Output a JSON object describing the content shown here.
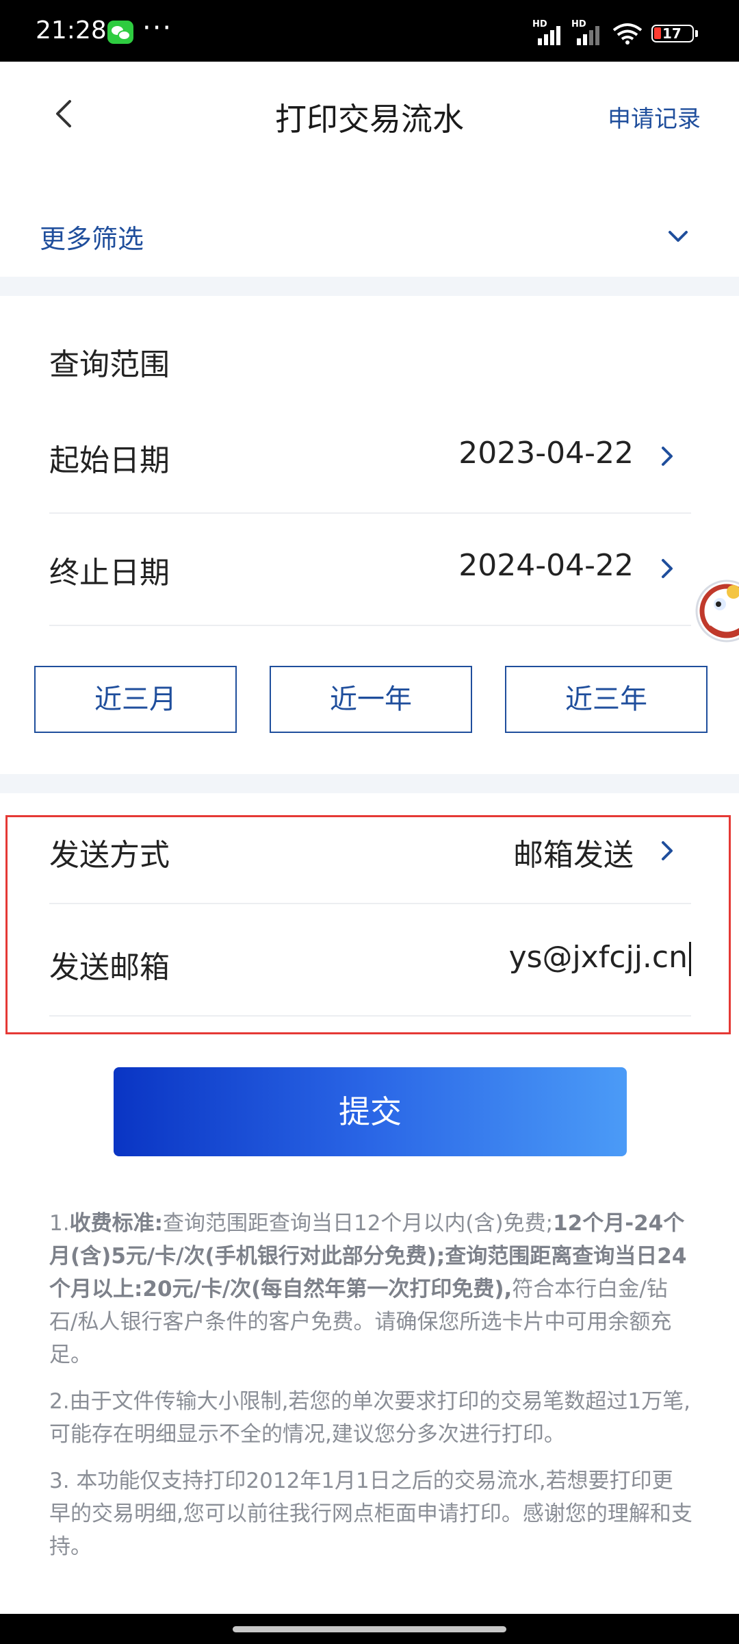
{
  "status_bar": {
    "time": "21:28",
    "more_dots": "···",
    "signal_1_label": "HD",
    "signal_2_label": "HD",
    "battery": "17",
    "icons": [
      "wechat-icon",
      "signal-icon",
      "wifi-icon",
      "battery-icon"
    ]
  },
  "nav": {
    "title": "打印交易流水",
    "action": "申请记录",
    "back_icon": "chevron-left-icon"
  },
  "filter": {
    "label": "更多筛选",
    "icon": "chevron-down-icon"
  },
  "query": {
    "section_title": "查询范围",
    "start_label": "起始日期",
    "start_value": "2023-04-22",
    "end_label": "终止日期",
    "end_value": "2024-04-22",
    "quick_ranges": [
      "近三月",
      "近一年",
      "近三年"
    ]
  },
  "send": {
    "method_label": "发送方式",
    "method_value": "邮箱发送",
    "email_label": "发送邮箱",
    "email_value": "ys@jxfcjj.cn"
  },
  "submit_label": "提交",
  "notes": {
    "n1_prefix": "1.",
    "n1_bold1": "收费标准:",
    "n1_text1": "查询范围距查询当日12个月以内(含)免费;",
    "n1_bold2": "12个月-24个月(含)5元/卡/次(手机银行对此部分免费);查询范围距离查询当日24个月以上:20元/卡/次(每自然年第一次打印免费),",
    "n1_text2": "符合本行白金/钻石/私人银行客户条件的客户免费。请确保您所选卡片中可用余额充足。",
    "n2": "2.由于文件传输大小限制,若您的单次要求打印的交易笔数超过1万笔,可能存在明细显示不全的情况,建议您分多次进行打印。",
    "n3": "3. 本功能仅支持打印2012年1月1日之后的交易流水,若想要打印更早的交易明细,您可以前往我行网点柜面申请打印。感谢您的理解和支持。"
  },
  "colors": {
    "accent": "#1f4e9c",
    "highlight": "#e53935",
    "submit_start": "#0a35c4",
    "submit_end": "#4b9bf7",
    "note_text": "#8a8e96"
  }
}
